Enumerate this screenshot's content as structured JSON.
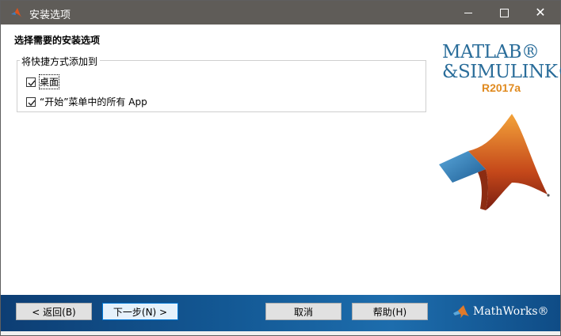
{
  "window": {
    "title": "安装选项",
    "controls": {
      "minimize": "minimize",
      "maximize": "maximize",
      "close": "close"
    }
  },
  "page": {
    "heading": "选择需要的安装选项",
    "group_label": "将快捷方式添加到",
    "options": [
      {
        "label": "桌面",
        "checked": true
      },
      {
        "label": "“开始”菜单中的所有 App",
        "checked": true
      }
    ]
  },
  "brand": {
    "line1": "MATLAB®",
    "line2": "&SIMULINK®",
    "release": "R2017a",
    "colors": {
      "text": "#2a6d9a",
      "release": "#e08a1f"
    }
  },
  "footer": {
    "back_label": "< 返回(B)",
    "next_label": "下一步(N) >",
    "cancel_label": "取消",
    "help_label": "帮助(H)",
    "vendor": "MathWorks®",
    "colors": {
      "bar": "#135894"
    }
  }
}
